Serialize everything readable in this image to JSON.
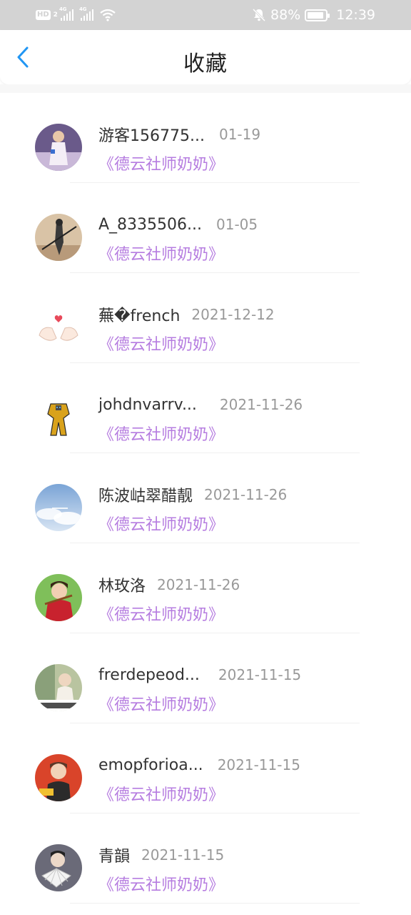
{
  "status_bar": {
    "hd_label": "HD",
    "sim_label": "2",
    "network_type_1": "4G",
    "network_type_2": "4G",
    "battery_percent": "88%",
    "time": "12:39",
    "icons": [
      "hd-icon",
      "signal-icon",
      "signal-icon",
      "wifi-icon",
      "mute-bell-icon",
      "battery-icon"
    ]
  },
  "header": {
    "title": "收藏",
    "back_icon": "chevron-left-icon",
    "accent_color": "#2196f3"
  },
  "colors": {
    "subtitle": "#b67de0",
    "name": "#333333",
    "date": "#999999"
  },
  "favorites": [
    {
      "name": "游客156775...",
      "date": "01-19",
      "subtitle": "《德云社师奶奶》",
      "avatar": "girl-in-white-dress"
    },
    {
      "name": "A_8335506...",
      "date": "01-05",
      "subtitle": "《德云社师奶奶》",
      "avatar": "swordsman-illustration"
    },
    {
      "name": "蕪�french",
      "date": "2021-12-12",
      "subtitle": "《德云社师奶奶》",
      "avatar": "hands-heart"
    },
    {
      "name": "johdnvarrv...",
      "date": "2021-11-26",
      "subtitle": "《德云社师奶奶》",
      "avatar": "transformer-robot"
    },
    {
      "name": "陈波岵翠醋靓",
      "date": "2021-11-26",
      "subtitle": "《德云社师奶奶》",
      "avatar": "blue-sky-clouds"
    },
    {
      "name": "林玫洛",
      "date": "2021-11-26",
      "subtitle": "《德云社师奶奶》",
      "avatar": "girl-with-violin"
    },
    {
      "name": "frerdepeod...",
      "date": "2021-11-15",
      "subtitle": "《德云社师奶奶》",
      "avatar": "girl-with-text"
    },
    {
      "name": "emopforioa...",
      "date": "2021-11-15",
      "subtitle": "《德云社师奶奶》",
      "avatar": "boy-red-background"
    },
    {
      "name": "青韻",
      "date": "2021-11-15",
      "subtitle": "《德云社师奶奶》",
      "avatar": "person-with-fan"
    }
  ]
}
